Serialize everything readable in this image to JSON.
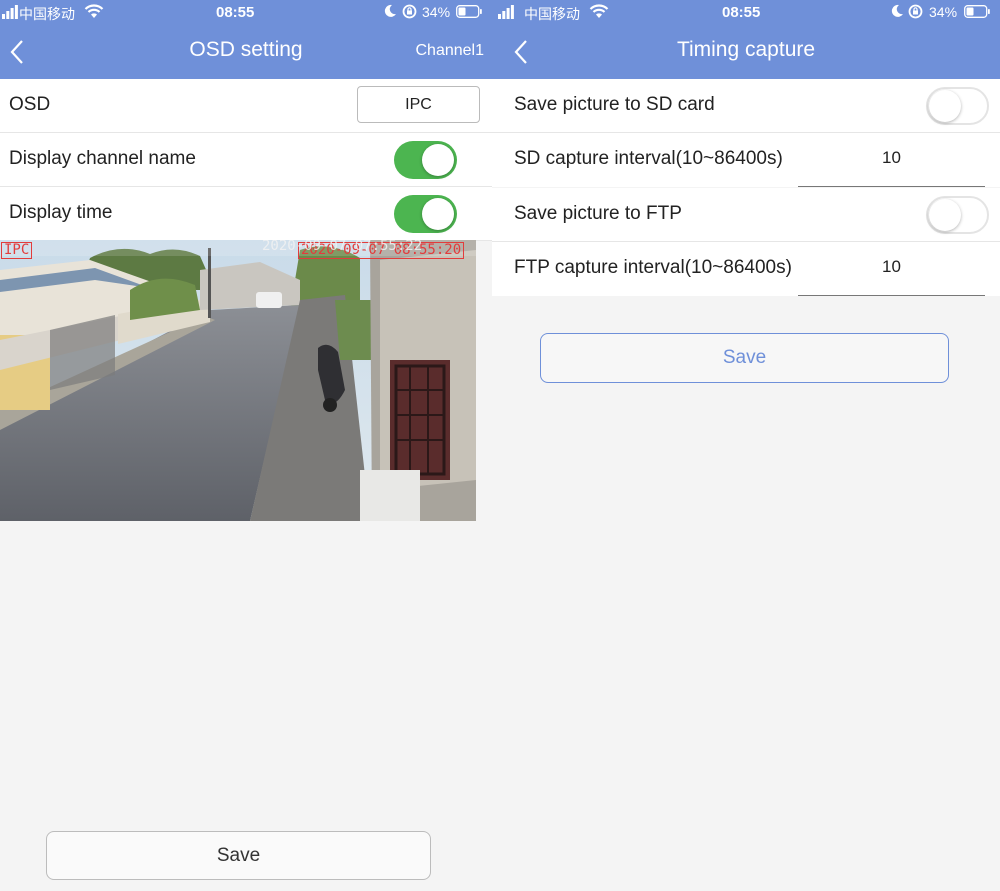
{
  "status_bar": {
    "carrier": "中国移动",
    "time": "08:55",
    "battery": "34%"
  },
  "left": {
    "title": "OSD setting",
    "right_label": "Channel1",
    "rows": {
      "osd_label": "OSD",
      "osd_button": "IPC",
      "channel_name_label": "Display channel name",
      "channel_name_on": true,
      "time_label": "Display time",
      "time_on": true
    },
    "preview": {
      "name_overlay": "IPC",
      "time_overlay": "2020-09-07 08:55:20",
      "camera_time": "2020-09-07 07:55:22"
    },
    "save_label": "Save"
  },
  "right": {
    "title": "Timing capture",
    "rows": {
      "sd_save_label": "Save picture to SD card",
      "sd_save_on": false,
      "sd_interval_label": "SD capture interval(10~86400s)",
      "sd_interval_value": "10",
      "ftp_save_label": "Save picture to FTP",
      "ftp_save_on": false,
      "ftp_interval_label": "FTP capture interval(10~86400s)",
      "ftp_interval_value": "10"
    },
    "save_label": "Save"
  },
  "colors": {
    "header": "#6f90d9",
    "toggle_on": "#4cb550",
    "save_accent": "#6f90d9"
  }
}
